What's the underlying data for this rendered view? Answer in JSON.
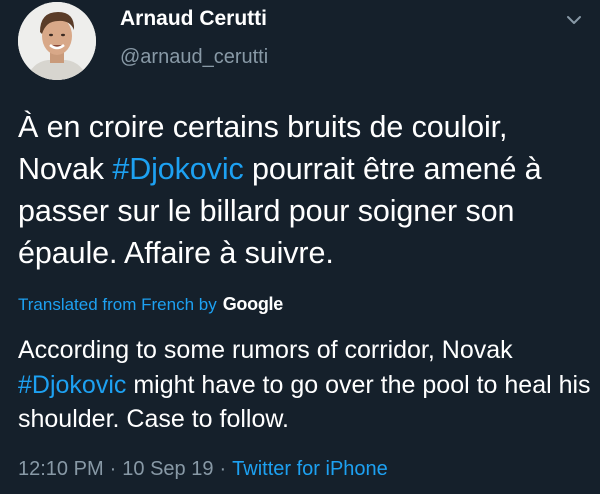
{
  "author": {
    "display_name": "Arnaud Cerutti",
    "handle": "@arnaud_cerutti"
  },
  "tweet": {
    "text_before_hashtag_1": "À en croire certains bruits de couloir, Novak ",
    "hashtag_1": "#Djokovic",
    "text_after_hashtag_1": " pourrait être amené à passer sur le billard pour soigner son épaule. Affaire à suivre."
  },
  "translation": {
    "label": "Translated from French by",
    "provider": "Google",
    "text_before_hashtag": "According to some rumors of corridor, Novak ",
    "hashtag": "#Djokovic",
    "text_after_hashtag": " might have to go over the pool to heal his shoulder. Case to follow."
  },
  "meta": {
    "time": "12:10 PM",
    "separator_1": "·",
    "date": "10 Sep 19",
    "separator_2": "·",
    "source": "Twitter for iPhone"
  },
  "icons": {
    "more_menu": "chevron-down-icon",
    "avatar": "profile-photo"
  },
  "colors": {
    "background": "#15202b",
    "accent": "#1da1f2",
    "secondary_text": "#8899a6",
    "primary_text": "#ffffff"
  }
}
